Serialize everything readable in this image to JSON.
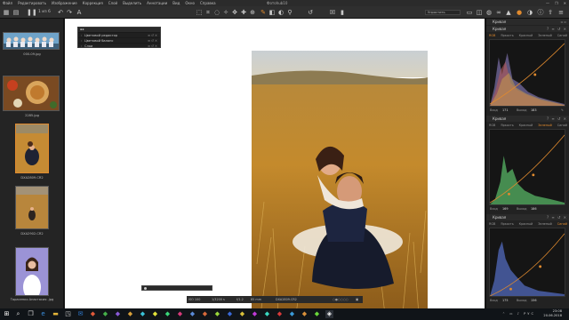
{
  "menubar": {
    "items": [
      "Файл",
      "Редактировать",
      "Изображение",
      "Коррекция",
      "Слой",
      "Выделить",
      "Аннотации",
      "Вид",
      "Окно",
      "Справка"
    ],
    "app_title": "Фотоhub10",
    "window_controls": [
      "—",
      "❐",
      "✕"
    ]
  },
  "toolbar": {
    "counter": "1 из 6",
    "workspace": "Упростить"
  },
  "browser": {
    "thumbs": [
      {
        "label": "000-09.jpg"
      },
      {
        "label": "2285.jpg"
      },
      {
        "label": "DXA2809.CR2"
      },
      {
        "label": "DXA2902.CR2"
      },
      {
        "label": "Тарасенко Анастасия .jpg"
      }
    ]
  },
  "tools_float": {
    "rows": [
      "Цветовой редактор",
      "Цветовой баланс",
      "Слои"
    ]
  },
  "viewer": {
    "status": {
      "iso": "ISO 100",
      "shutter": "1/3200 s",
      "aperture": "f/1.2",
      "focal": "85 mm",
      "filename": "DXA2809.CR2"
    }
  },
  "rightpanel": {
    "sections": [
      {
        "title": "Кривая",
        "channels": [
          "RGB",
          "Яркость",
          "Красный",
          "Зеленый",
          "Синий"
        ],
        "active_channel": "RGB",
        "in_label": "Вход",
        "in_value": "171",
        "out_label": "Выход",
        "out_value": "183"
      },
      {
        "title": "Кривая",
        "channels": [
          "RGB",
          "Яркость",
          "Красный",
          "Зеленый",
          "Синий"
        ],
        "active_channel": "Зеленый",
        "in_label": "Вход",
        "in_value": "169",
        "out_label": "Выход",
        "out_value": "186"
      },
      {
        "title": "Кривая",
        "channels": [
          "RGB",
          "Яркость",
          "Красный",
          "Зеленый",
          "Синий"
        ],
        "active_channel": "Синий",
        "in_label": "Вход",
        "in_value": "175",
        "out_label": "Выход",
        "out_value": "156"
      }
    ],
    "top_section": "Кривая"
  },
  "taskbar": {
    "tray": "РУС",
    "time": "23:08",
    "date": "20.06.2018"
  },
  "colors": {
    "accent": "#e08a2e"
  }
}
